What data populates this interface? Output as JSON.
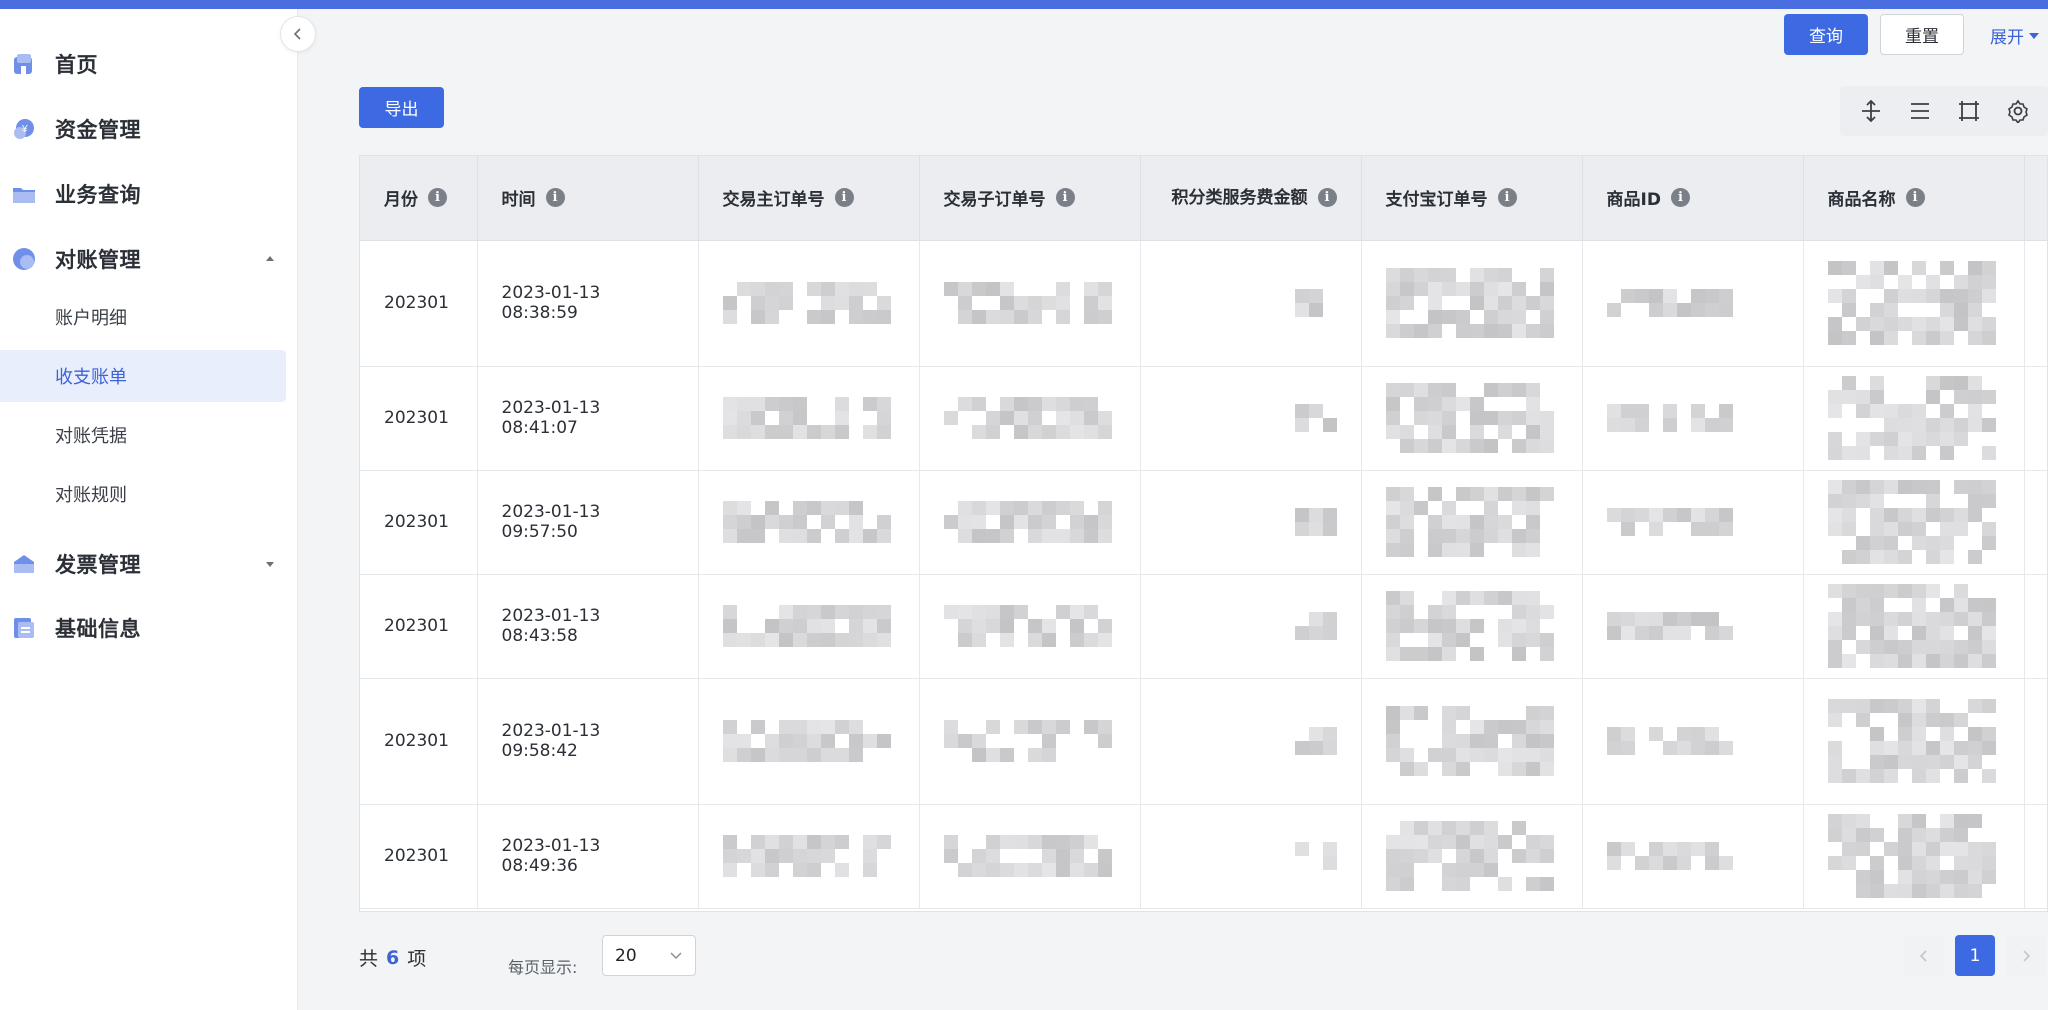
{
  "sidebar": {
    "menu": [
      {
        "label": "首页",
        "icon": "home-icon"
      },
      {
        "label": "资金管理",
        "icon": "money-icon"
      },
      {
        "label": "业务查询",
        "icon": "folder-icon"
      },
      {
        "label": "对账管理",
        "icon": "reconcile-icon",
        "expanded": true
      },
      {
        "label": "发票管理",
        "icon": "invoice-icon",
        "expanded": false
      },
      {
        "label": "基础信息",
        "icon": "document-icon"
      }
    ],
    "submenu": [
      {
        "label": "账户明细"
      },
      {
        "label": "收支账单",
        "active": true
      },
      {
        "label": "对账凭据"
      },
      {
        "label": "对账规则"
      }
    ]
  },
  "header": {
    "query_label": "查询",
    "reset_label": "重置",
    "expand_label": "展开"
  },
  "toolbar": {
    "export_label": "导出",
    "icons": [
      "column-height-icon",
      "density-icon",
      "fullscreen-icon",
      "settings-icon"
    ]
  },
  "table": {
    "columns": [
      "月份",
      "时间",
      "交易主订单号",
      "交易子订单号",
      "积分类服务费金额",
      "支付宝订单号",
      "商品ID",
      "商品名称"
    ],
    "rows": [
      {
        "month": "202301",
        "time": "2023-01-13 08:38:59"
      },
      {
        "month": "202301",
        "time": "2023-01-13 08:41:07"
      },
      {
        "month": "202301",
        "time": "2023-01-13 09:57:50"
      },
      {
        "month": "202301",
        "time": "2023-01-13 08:43:58"
      },
      {
        "month": "202301",
        "time": "2023-01-13 09:58:42"
      },
      {
        "month": "202301",
        "time": "2023-01-13 08:49:36"
      }
    ]
  },
  "pagination": {
    "total_prefix": "共",
    "total_count": "6",
    "total_suffix": "项",
    "page_size_label": "每页显示:",
    "page_size": "20",
    "current_page": "1"
  },
  "colors": {
    "accent": "#3d6ae2",
    "topbar": "#4a6ee0",
    "active_bg": "#e8eefc"
  }
}
